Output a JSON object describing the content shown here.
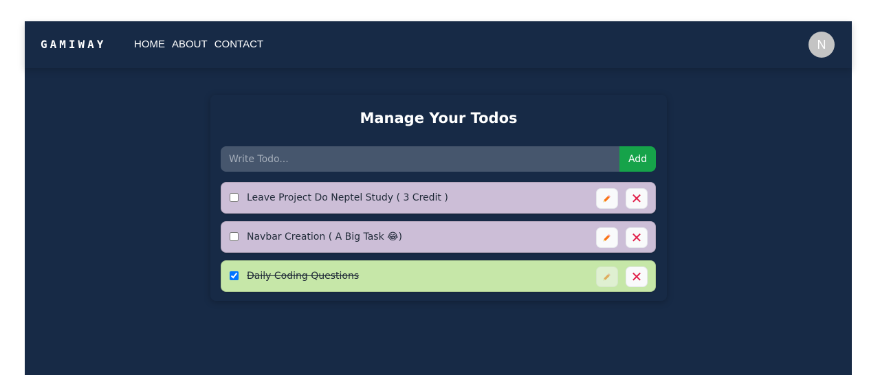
{
  "navbar": {
    "logo": "GAMIWAY",
    "links": [
      "HOME",
      "ABOUT",
      "CONTACT"
    ],
    "avatar_initial": "N"
  },
  "todo_card": {
    "title": "Manage Your Todos",
    "input_placeholder": "Write Todo...",
    "input_value": "",
    "add_label": "Add"
  },
  "todos": [
    {
      "text": "Leave Project Do Neptel Study ( 3 Credit  )",
      "completed": false,
      "edit_icon": "pencil-icon",
      "delete_icon": "cross-icon"
    },
    {
      "text": "Navbar Creation ( A Big Task 😂)",
      "completed": false,
      "edit_icon": "pencil-icon",
      "delete_icon": "cross-icon"
    },
    {
      "text": "Daily Coding Questions",
      "completed": true,
      "edit_icon": "pencil-icon",
      "delete_icon": "cross-icon"
    }
  ],
  "colors": {
    "app_background": "#172a46",
    "todo_pending": "#ccbed7",
    "todo_done": "#c6e7a8",
    "add_button": "#16a34a",
    "delete_icon": "#e11d48",
    "edit_icon": "#f97316"
  }
}
